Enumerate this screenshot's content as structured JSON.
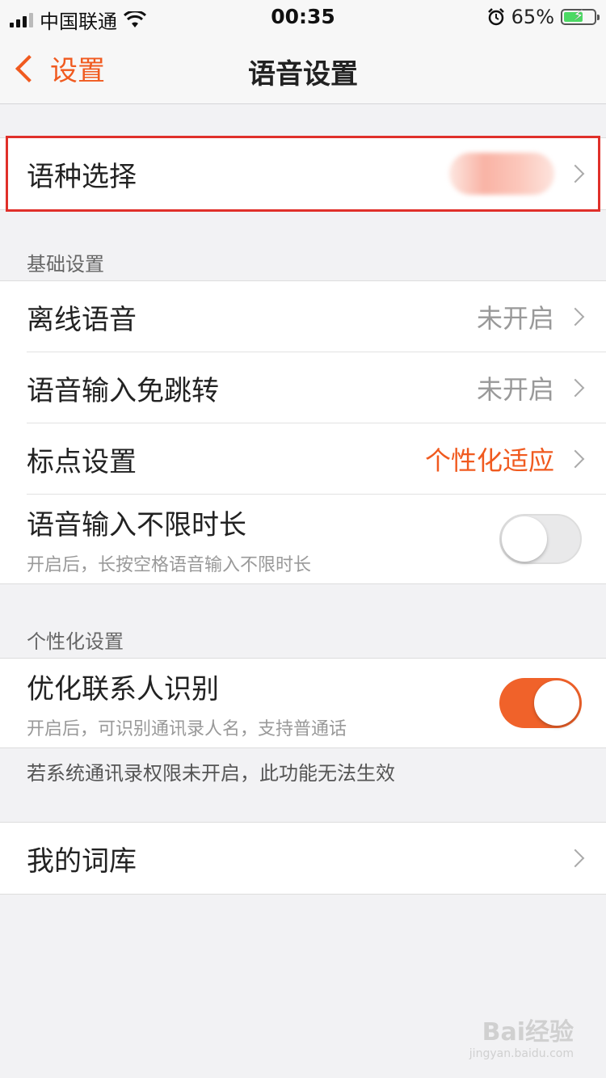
{
  "status_bar": {
    "carrier": "中国联通",
    "time": "00:35",
    "battery": "65%",
    "battery_level": 0.65
  },
  "nav": {
    "back_label": "设置",
    "title": "语音设置"
  },
  "language": {
    "label": "语种选择"
  },
  "basic": {
    "header": "基础设置",
    "offline_label": "离线语音",
    "offline_value": "未开启",
    "nojump_label": "语音输入免跳转",
    "nojump_value": "未开启",
    "punct_label": "标点设置",
    "punct_value": "个性化适应",
    "unlimited_label": "语音输入不限时长",
    "unlimited_sub": "开启后，长按空格语音输入不限时长",
    "unlimited_on": false
  },
  "personal": {
    "header": "个性化设置",
    "contact_label": "优化联系人识别",
    "contact_sub": "开启后，可识别通讯录人名，支持普通话",
    "contact_on": true,
    "note": "若系统通讯录权限未开启，此功能无法生效"
  },
  "lexicon": {
    "label": "我的词库"
  },
  "watermark": {
    "brand": "Bai经验",
    "url": "jingyan.baidu.com"
  },
  "colors": {
    "accent": "#f05a1f",
    "toggle_on": "#f0622a",
    "highlight": "#e0302a"
  }
}
